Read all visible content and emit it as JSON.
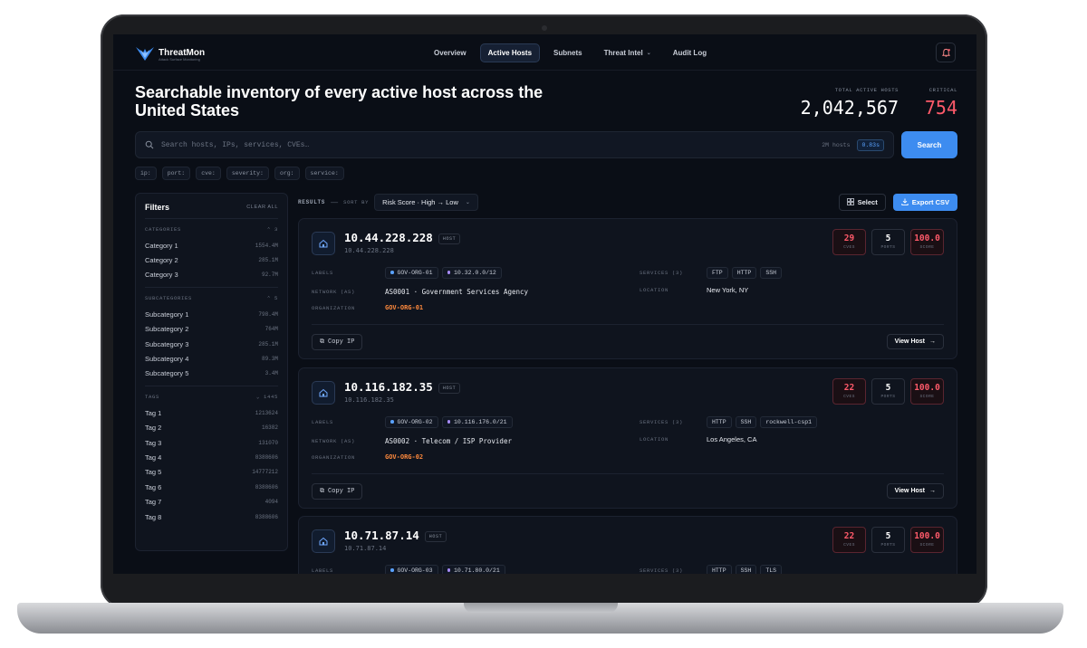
{
  "app": {
    "name": "ThreatMon",
    "tagline": "Attack Surface Monitoring"
  },
  "nav": [
    {
      "label": "Overview",
      "active": false
    },
    {
      "label": "Active Hosts",
      "active": true
    },
    {
      "label": "Subnets",
      "active": false
    },
    {
      "label": "Threat Intel",
      "active": false,
      "dropdown": true
    },
    {
      "label": "Audit Log",
      "active": false
    }
  ],
  "hero": {
    "title": "Searchable inventory of every active host across the United States"
  },
  "stats": {
    "total_label": "TOTAL ACTIVE HOSTS",
    "total_value": "2,042,567",
    "critical_label": "CRITICAL",
    "critical_value": "754"
  },
  "search": {
    "placeholder": "Search hosts, IPs, services, CVEs…",
    "meta": "2M hosts",
    "time": "0.83s",
    "button": "Search"
  },
  "chips": [
    "ip:",
    "port:",
    "cve:",
    "severity:",
    "org:",
    "service:"
  ],
  "filters": {
    "title": "Filters",
    "clear": "CLEAR ALL",
    "categories": {
      "label": "CATEGORIES",
      "count": "3",
      "items": [
        {
          "label": "Category 1",
          "count": "1554.4M"
        },
        {
          "label": "Category 2",
          "count": "285.1M"
        },
        {
          "label": "Category 3",
          "count": "92.7M"
        }
      ]
    },
    "subcategories": {
      "label": "SUBCATEGORIES",
      "count": "5",
      "items": [
        {
          "label": "Subcategory 1",
          "count": "798.4M"
        },
        {
          "label": "Subcategory 2",
          "count": "764M"
        },
        {
          "label": "Subcategory 3",
          "count": "285.1M"
        },
        {
          "label": "Subcategory 4",
          "count": "89.3M"
        },
        {
          "label": "Subcategory 5",
          "count": "3.4M"
        }
      ]
    },
    "tags": {
      "label": "TAGS",
      "count": "1445",
      "items": [
        {
          "label": "Tag 1",
          "count": "1213624"
        },
        {
          "label": "Tag 2",
          "count": "16382"
        },
        {
          "label": "Tag 3",
          "count": "131070"
        },
        {
          "label": "Tag 4",
          "count": "8388606"
        },
        {
          "label": "Tag 5",
          "count": "14777212"
        },
        {
          "label": "Tag 6",
          "count": "8388606"
        },
        {
          "label": "Tag 7",
          "count": "4094"
        },
        {
          "label": "Tag 8",
          "count": "8388606"
        }
      ]
    }
  },
  "results": {
    "label": "RESULTS",
    "sort_label": "SORT BY",
    "sort_value": "Risk Score · High → Low",
    "select": "Select",
    "export": "Export CSV"
  },
  "hosts": [
    {
      "ip": "10.44.228.228",
      "badge": "HOST",
      "sub": "10.44.228.228",
      "cves": "29",
      "ports": "5",
      "score": "100.0",
      "labels": [
        "GOV-ORG-01",
        "10.32.0.0/12"
      ],
      "network": "AS0001 · Government Services Agency",
      "org": "GOV-ORG-01",
      "services_label": "SERVICES (3)",
      "services": [
        "FTP",
        "HTTP",
        "SSH"
      ],
      "location": "New York, NY"
    },
    {
      "ip": "10.116.182.35",
      "badge": "HOST",
      "sub": "10.116.182.35",
      "cves": "22",
      "ports": "5",
      "score": "100.0",
      "labels": [
        "GOV-ORG-02",
        "10.116.176.0/21"
      ],
      "network": "AS0002 · Telecom / ISP Provider",
      "org": "GOV-ORG-02",
      "services_label": "SERVICES (3)",
      "services": [
        "HTTP",
        "SSH",
        "rockwell-csp1"
      ],
      "location": "Los Angeles, CA"
    },
    {
      "ip": "10.71.87.14",
      "badge": "HOST",
      "sub": "10.71.87.14",
      "cves": "22",
      "ports": "5",
      "score": "100.0",
      "labels": [
        "GOV-ORG-03",
        "10.71.80.0/21"
      ],
      "network": "",
      "org": "",
      "services_label": "SERVICES (3)",
      "services": [
        "HTTP",
        "SSH",
        "TLS"
      ],
      "location": ""
    }
  ],
  "card_labels": {
    "labels": "LABELS",
    "network": "NETWORK (AS)",
    "org": "ORGANIZATION",
    "location": "LOCATION",
    "cves": "CVES",
    "ports": "PORTS",
    "score": "SCORE",
    "copy": "Copy IP",
    "view": "View Host"
  },
  "colors": {
    "accent": "#3d8cf0",
    "critical": "#ff5a6a",
    "org": "#ff8a3d",
    "bg": "#0a0e16"
  }
}
